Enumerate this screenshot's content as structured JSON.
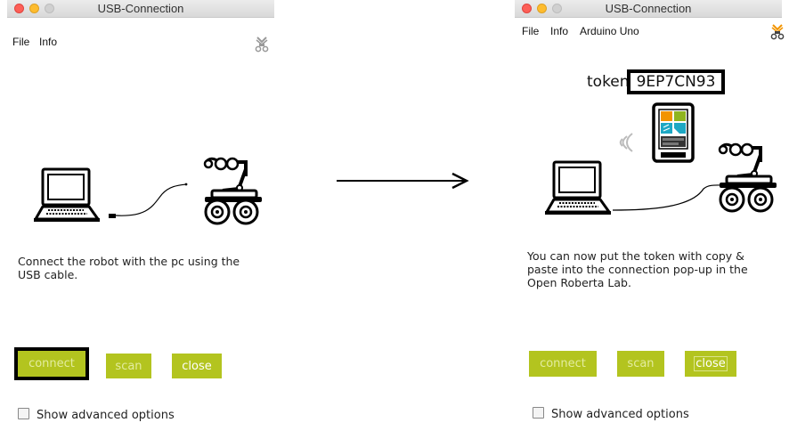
{
  "left_window": {
    "title": "USB-Connection",
    "menu": [
      "File",
      "Info"
    ],
    "message_lines": [
      "Connect the robot with the pc using the",
      "USB cable."
    ],
    "buttons": {
      "connect": "connect",
      "scan": "scan",
      "close": "close"
    },
    "focused_button": "connect",
    "advanced_options_label": "Show advanced options",
    "advanced_options_checked": false
  },
  "right_window": {
    "title": "USB-Connection",
    "menu": [
      "File",
      "Info",
      "Arduino Uno"
    ],
    "token_label": "token",
    "token_value": "9EP7CN93",
    "message_lines": [
      "You can now put the token with copy &",
      "paste into the connection pop-up in the",
      "Open Roberta Lab."
    ],
    "buttons": {
      "connect": "connect",
      "scan": "scan",
      "close": "close"
    },
    "advanced_options_label": "Show advanced options",
    "advanced_options_checked": false
  },
  "colors": {
    "button_green": "#b3c41f",
    "logo_orange": "#f29400",
    "tablet_orange": "#f29400",
    "tablet_green": "#8fb51f",
    "tablet_blue": "#1da8c4"
  }
}
